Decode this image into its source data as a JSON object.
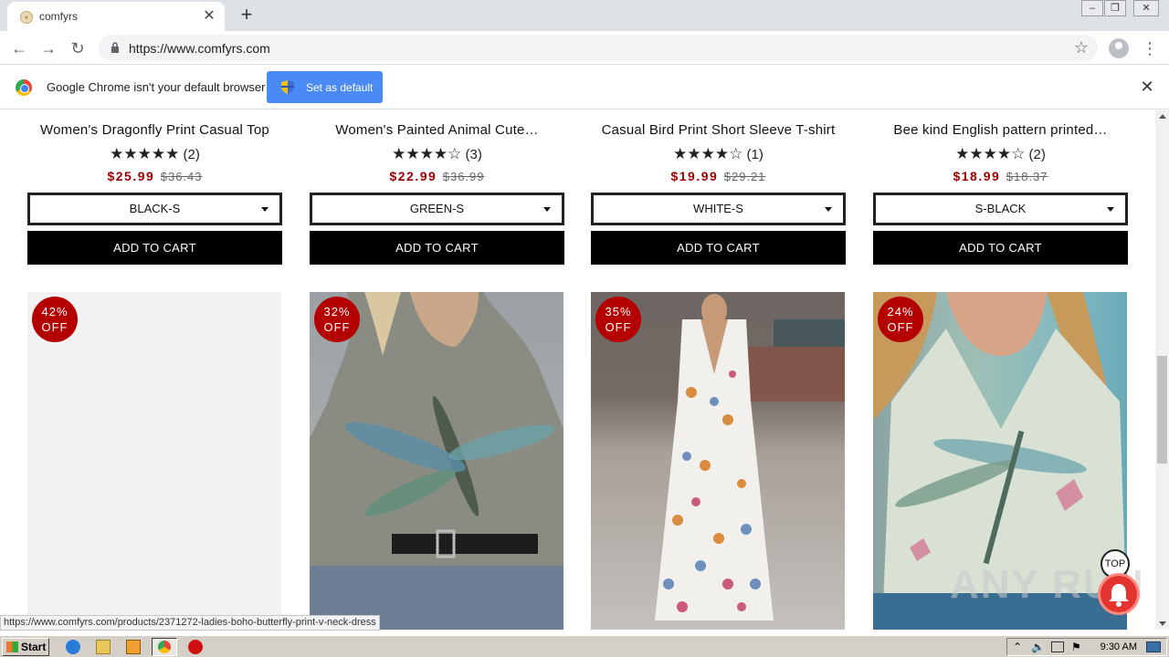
{
  "browser": {
    "tab_title": "comfyrs",
    "url": "https://www.comfyrs.com",
    "window_controls": [
      "–",
      "❐",
      "✕"
    ]
  },
  "infobar": {
    "message": "Google Chrome isn't your default browser",
    "button": "Set as default"
  },
  "products_top": [
    {
      "name": "Women's Dragonfly Print Casual Top",
      "stars": "★★★★★",
      "count": "(2)",
      "price": "$25.99",
      "old_price": "$36.43",
      "option": "BLACK-S",
      "cart": "ADD TO CART"
    },
    {
      "name": "Women's Painted Animal Cute…",
      "stars": "★★★★☆",
      "count": "(3)",
      "price": "$22.99",
      "old_price": "$36.99",
      "option": "GREEN-S",
      "cart": "ADD TO CART"
    },
    {
      "name": "Casual Bird Print Short Sleeve T-shirt",
      "stars": "★★★★☆",
      "count": "(1)",
      "price": "$19.99",
      "old_price": "$29.21",
      "option": "WHITE-S",
      "cart": "ADD TO CART"
    },
    {
      "name": "Bee kind English pattern printed…",
      "stars": "★★★★☆",
      "count": "(2)",
      "price": "$18.99",
      "old_price": "$18.37",
      "option": "S-BLACK",
      "cart": "ADD TO CART"
    }
  ],
  "products_bottom": [
    {
      "discount": "42%",
      "off": "OFF"
    },
    {
      "discount": "32%",
      "off": "OFF"
    },
    {
      "discount": "35%",
      "off": "OFF"
    },
    {
      "discount": "24%",
      "off": "OFF"
    }
  ],
  "status_url": "https://www.comfyrs.com/products/2371272-ladies-boho-butterfly-print-v-neck-dress",
  "top_button": "TOP",
  "watermark": "ANY RUN",
  "taskbar": {
    "start": "Start",
    "clock": "9:30 AM"
  }
}
